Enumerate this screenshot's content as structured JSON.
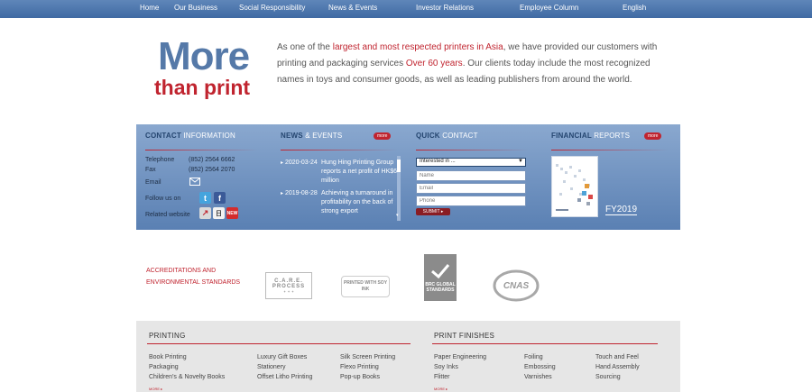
{
  "nav": [
    "Home",
    "Our Business",
    "Social Responsibility",
    "News & Events",
    "Investor Relations",
    "Employee Column",
    "English"
  ],
  "hero": {
    "logo_line1": "More",
    "logo_line2": "than print",
    "intro_a": "As one of the ",
    "intro_hl1": "largest and most respected printers in Asia",
    "intro_b": ", we have provided our customers with printing and packaging services ",
    "intro_hl2": "Over 60 years",
    "intro_c": ".  Our clients today include the most recognized names in toys and consumer goods, as well as leading publishers from around the world."
  },
  "contact": {
    "title_dark": "CONTACT",
    "title_light": "INFORMATION",
    "telephone_label": "Telephone",
    "telephone_value": "(852) 2564 6662",
    "fax_label": "Fax",
    "fax_value": "(852) 2564 2070",
    "email_label": "Email",
    "follow_label": "Follow us on",
    "related_label": "Related website"
  },
  "news": {
    "title_dark": "NEWS",
    "title_light": "& EVENTS",
    "more": "more",
    "items": [
      {
        "date": "2020-03-24",
        "text": "Hung Hing Printing Group reports a net profit of HK$68 million"
      },
      {
        "date": "2019-08-28",
        "text": "Achieving a turnaround in profitability on the back of strong export"
      }
    ]
  },
  "quick": {
    "title_dark": "QUICK",
    "title_light": "CONTACT",
    "select_value": "Interested in ...",
    "name_placeholder": "Name",
    "email_placeholder": "Email",
    "phone_placeholder": "Phone",
    "submit": "SUBMIT ▸"
  },
  "financial": {
    "title_dark": "FINANCIAL",
    "title_light": "REPORTS",
    "more": "more",
    "year": "FY2019"
  },
  "accreditations": {
    "label_line1": "ACCREDITATIONS AND",
    "label_line2": "ENVIRONMENTAL STANDARDS",
    "logos": [
      "C.A.R.E. PROCESS",
      "PRINTED WITH SOY INK",
      "BRC GLOBAL STANDARDS",
      "CNAS"
    ]
  },
  "footer": {
    "printing_title": "PRINTING",
    "finishes_title": "PRINT FINISHES",
    "printing_col1": [
      "Book Printing",
      "Packaging",
      "Children's & Novelty Books"
    ],
    "printing_col2": [
      "Luxury Gift Boxes",
      "Stationery",
      "Offset Litho Printing"
    ],
    "printing_col3": [
      "Silk Screen Printing",
      "Flexo Printing",
      "Pop-up Books"
    ],
    "finishes_col1": [
      "Paper Engineering",
      "Soy Inks",
      "Flitter"
    ],
    "finishes_col2": [
      "Foiling",
      "Embossing",
      "Varnishes"
    ],
    "finishes_col3": [
      "Touch and Feel",
      "Hand Assembly",
      "Sourcing"
    ],
    "more": "MORE ▸"
  }
}
